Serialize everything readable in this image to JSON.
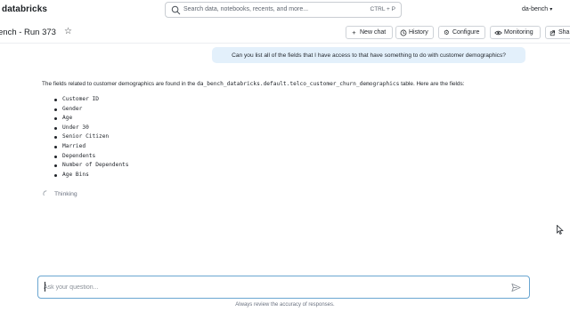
{
  "app": {
    "brand": "databricks",
    "user": "da-bench"
  },
  "search": {
    "placeholder": "Search data, notebooks, recents, and more...",
    "shortcut": "CTRL + P"
  },
  "page": {
    "title": "ench - Run 373"
  },
  "toolbar": {
    "new_chat": "New chat",
    "history": "History",
    "configure": "Configure",
    "monitoring": "Monitoring",
    "share": "Sha"
  },
  "conversation": {
    "user_message": "Can you list all of the fields that I have access to that have something to do with customer demographics?",
    "answer_intro_before": "The fields related to customer demographics are found in the ",
    "answer_table": "da_bench_databricks.default.telco_customer_churn_demographics",
    "answer_intro_after": " table. Here are the fields:",
    "fields": [
      "Customer ID",
      "Gender",
      "Age",
      "Under 30",
      "Senior Citizen",
      "Married",
      "Dependents",
      "Number of Dependents",
      "Age Bins"
    ],
    "status": "Thinking"
  },
  "input": {
    "placeholder": "Ask your question...",
    "disclaimer": "Always review the accuracy of responses."
  }
}
